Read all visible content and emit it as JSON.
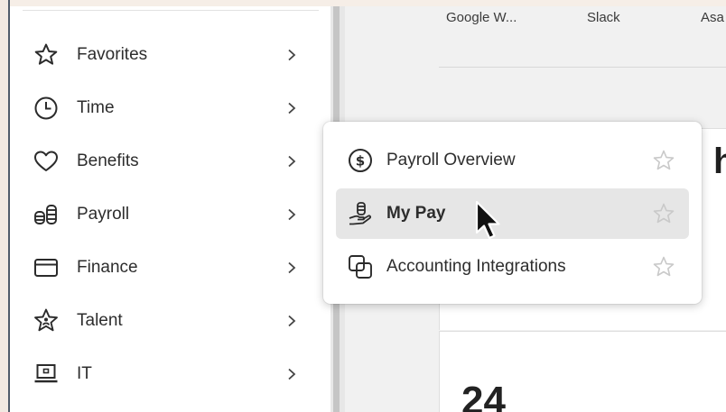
{
  "sidebar": {
    "items": [
      {
        "label": "Favorites",
        "icon": "star-icon"
      },
      {
        "label": "Time",
        "icon": "clock-icon"
      },
      {
        "label": "Benefits",
        "icon": "heart-icon"
      },
      {
        "label": "Payroll",
        "icon": "coins-icon"
      },
      {
        "label": "Finance",
        "icon": "card-icon"
      },
      {
        "label": "Talent",
        "icon": "star-person-icon"
      },
      {
        "label": "IT",
        "icon": "laptop-icon"
      }
    ]
  },
  "main": {
    "apps": [
      "Google W...",
      "Slack",
      "Asa"
    ],
    "heading_fragment": "h",
    "stat_fragment": "24"
  },
  "flyout": {
    "items": [
      {
        "label": "Payroll Overview",
        "icon": "dollar-circle-icon",
        "active": false
      },
      {
        "label": "My Pay",
        "icon": "hand-coins-icon",
        "active": true
      },
      {
        "label": "Accounting Integrations",
        "icon": "integration-icon",
        "active": false
      }
    ]
  },
  "colors": {
    "sidebar_bg": "#ffffff",
    "page_bg": "#f1f1f1",
    "active_item_bg": "#e6e6e6",
    "star_outline": "#c9c9c9"
  }
}
